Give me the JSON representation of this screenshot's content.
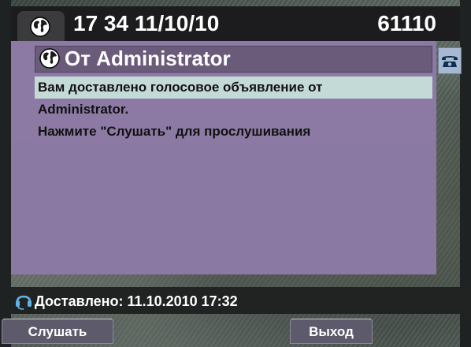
{
  "header": {
    "time_date": "17 34 11/10/10",
    "extension": "61110"
  },
  "message": {
    "title": "От Administrator",
    "lines": [
      "Вам доставлено голосовое объявление от",
      "Administrator.",
      "Нажмите \"Слушать\" для прослушивания"
    ]
  },
  "status": {
    "text": "Доставлено: 11.10.2010 17:32"
  },
  "softkeys": {
    "listen": "Слушать",
    "exit": "Выход"
  },
  "icons": {
    "header": "globe-icon",
    "title": "globe-icon",
    "side": "phone-icon",
    "status": "headset-icon"
  },
  "colors": {
    "panel": "#8c7aa4",
    "title_bar": "#6a5b7b",
    "highlight": "#c3dad7",
    "header": "#1c1c1e",
    "phone_box": "#a6b9d1"
  }
}
